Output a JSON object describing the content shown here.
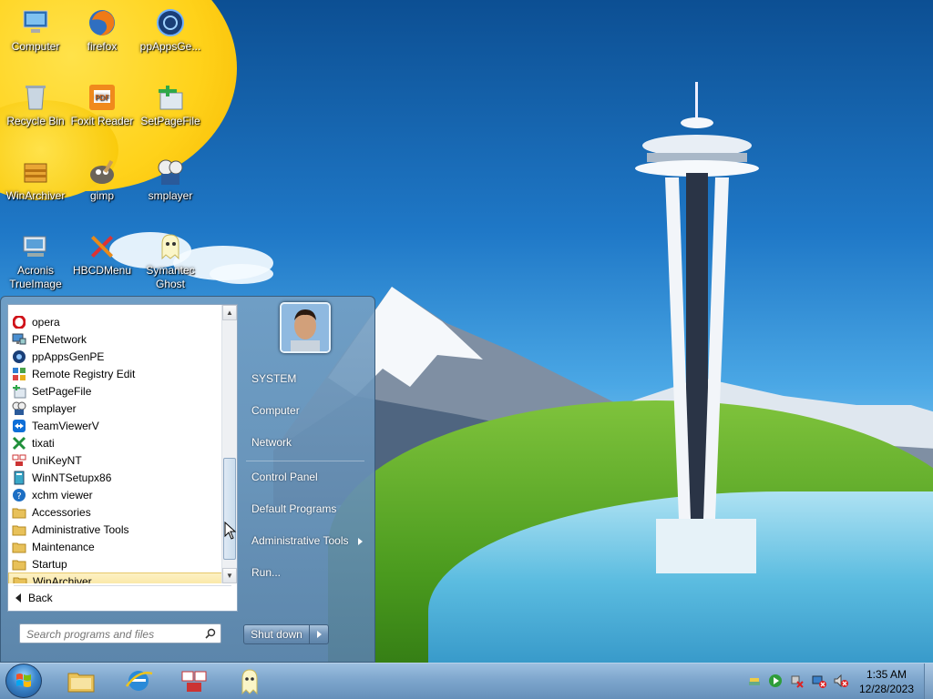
{
  "desktop": {
    "icons": [
      {
        "label": "Computer"
      },
      {
        "label": "firefox"
      },
      {
        "label": "ppAppsGe..."
      },
      {
        "label": "Recycle Bin"
      },
      {
        "label": "Foxit Reader"
      },
      {
        "label": "SetPageFile"
      },
      {
        "label": "WinArchiver"
      },
      {
        "label": "gimp"
      },
      {
        "label": "smplayer"
      },
      {
        "label": "Acronis TrueImage"
      },
      {
        "label": "HBCDMenu"
      },
      {
        "label": "Symantec Ghost"
      }
    ]
  },
  "start_menu": {
    "programs": [
      {
        "label": "opera",
        "icon": "opera-icon"
      },
      {
        "label": "PENetwork",
        "icon": "network-icon"
      },
      {
        "label": "ppAppsGenPE",
        "icon": "ppapps-icon"
      },
      {
        "label": "Remote Registry Edit",
        "icon": "registry-icon"
      },
      {
        "label": "SetPageFile",
        "icon": "setpagefile-icon"
      },
      {
        "label": "smplayer",
        "icon": "smplayer-icon"
      },
      {
        "label": "TeamViewerV",
        "icon": "teamviewer-icon"
      },
      {
        "label": "tixati",
        "icon": "tixati-icon"
      },
      {
        "label": "UniKeyNT",
        "icon": "unikey-icon"
      },
      {
        "label": "WinNTSetupx86",
        "icon": "winntsetup-icon"
      },
      {
        "label": "xchm viewer",
        "icon": "xchm-icon"
      },
      {
        "label": "Accessories",
        "icon": "folder-icon"
      },
      {
        "label": "Administrative Tools",
        "icon": "folder-icon"
      },
      {
        "label": "Maintenance",
        "icon": "folder-icon"
      },
      {
        "label": "Startup",
        "icon": "folder-icon"
      },
      {
        "label": "WinArchiver",
        "icon": "folder-icon",
        "selected": true
      }
    ],
    "back_label": "Back",
    "search_placeholder": "Search programs and files",
    "right_items": {
      "user": "SYSTEM",
      "computer": "Computer",
      "network": "Network",
      "control_panel": "Control Panel",
      "default_programs": "Default Programs",
      "admin_tools": "Administrative Tools",
      "run": "Run..."
    },
    "shutdown_label": "Shut down"
  },
  "taskbar": {
    "clock_time": "1:35 AM",
    "clock_date": "12/28/2023"
  },
  "colors": {
    "start_menu_blue": "#6f98c0",
    "selected_item": "#f9e49a",
    "taskbar": "#7ea6cd"
  }
}
